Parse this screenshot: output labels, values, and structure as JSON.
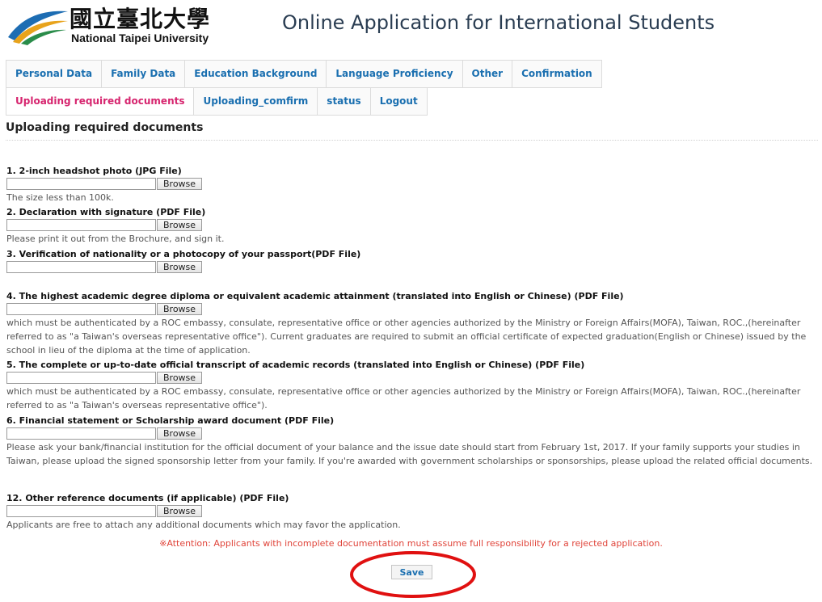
{
  "header": {
    "logo_cn": "國立臺北大學",
    "logo_en": "National Taipei University",
    "app_title": "Online Application for International Students"
  },
  "tabs_row1": [
    {
      "label": "Personal Data"
    },
    {
      "label": "Family Data"
    },
    {
      "label": "Education Background"
    },
    {
      "label": "Language Proficiency"
    },
    {
      "label": "Other"
    },
    {
      "label": "Confirmation"
    }
  ],
  "tabs_row2": [
    {
      "label": "Uploading required documents",
      "active": true
    },
    {
      "label": "Uploading_comfirm"
    },
    {
      "label": "status"
    },
    {
      "label": "Logout"
    }
  ],
  "section": {
    "title": "Uploading required documents"
  },
  "browse_label": "Browse",
  "documents": [
    {
      "label": "1. 2-inch headshot photo (JPG File)",
      "note": "The size less than 100k."
    },
    {
      "label": "2. Declaration with signature (PDF File)",
      "note": "Please print it out from the Brochure, and sign it."
    },
    {
      "label": "3. Verification of nationality or a photocopy of your passport(PDF File)",
      "note": ""
    },
    {
      "label": "4. The highest academic degree diploma or equivalent academic attainment (translated into English or Chinese) (PDF File)",
      "note": "which must be authenticated by a ROC embassy, consulate, representative office or other agencies authorized by the Ministry or Foreign Affairs(MOFA), Taiwan, ROC.,(hereinafter referred to as \"a Taiwan's overseas representative office\"). Current graduates are required to submit an official certificate of expected graduation(English or Chinese) issued by the school in lieu of the diploma at the time of application."
    },
    {
      "label": "5. The complete or up-to-date official transcript of academic records (translated into English or Chinese) (PDF File)",
      "note": "which must be authenticated by a ROC embassy, consulate, representative office or other agencies authorized by the Ministry or Foreign Affairs(MOFA), Taiwan, ROC.,(hereinafter referred to as \"a Taiwan's overseas representative office\")."
    },
    {
      "label": "6. Financial statement or Scholarship award document (PDF File)",
      "note": "Please ask your bank/financial institution for the official document of your balance and the issue date should start from February 1st, 2017. If your family supports your studies in Taiwan, please upload the signed sponsorship letter from your family. If you're awarded with government scholarships or sponsorships, please upload the related official documents."
    },
    {
      "label": "12. Other reference documents (if applicable) (PDF File)",
      "note": "Applicants are free to attach any additional documents which may favor the application."
    }
  ],
  "attention": "※Attention: Applicants with incomplete documentation must assume full responsibility for a rejected application.",
  "save_label": "Save",
  "colors": {
    "tab_link": "#1a6fb0",
    "tab_active": "#d6246e",
    "attention": "#e0443a",
    "highlight_circle": "#e01010"
  }
}
